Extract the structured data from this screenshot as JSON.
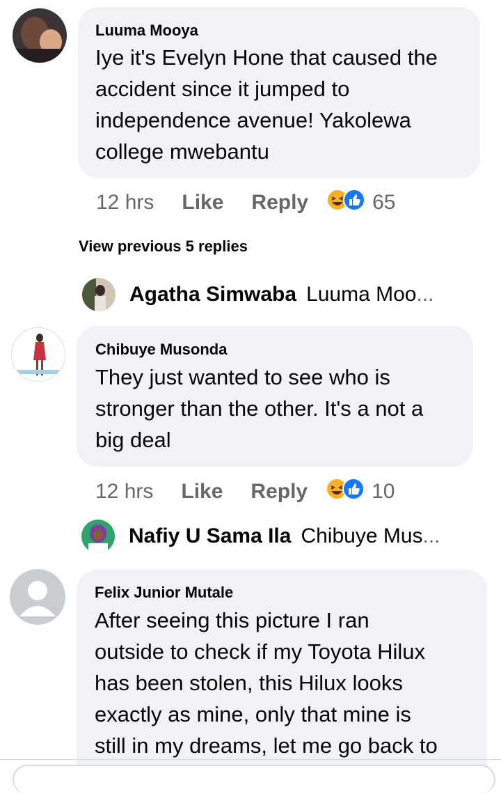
{
  "comments": [
    {
      "author": "Luuma Mooya",
      "lines": [
        "Iye it's Evelyn Hone that caused the",
        "accident since it jumped to",
        "independence avenue! Yakolewa",
        "college mwebantu"
      ],
      "time": "12 hrs",
      "like_label": "Like",
      "reply_label": "Reply",
      "reaction_count": "65"
    },
    {
      "author": "Chibuye Musonda",
      "lines": [
        "They just wanted to see who is",
        "stronger than the other. It's a not a",
        "big deal"
      ],
      "time": "12 hrs",
      "like_label": "Like",
      "reply_label": "Reply",
      "reaction_count": "10"
    },
    {
      "author": "Felix Junior Mutale",
      "lines": [
        "After seeing this picture I ran",
        "outside to check if my Toyota Hilux",
        "has been stolen, this Hilux looks",
        "exactly as mine, only that mine is",
        "still in my dreams, let me go back to"
      ]
    }
  ],
  "view_previous": "View previous 5 replies",
  "replies": [
    {
      "name": "Agatha Simwaba",
      "snippet": "Luuma Moo",
      "ellipsis": "..."
    },
    {
      "name": "Nafiy U Sama Ila",
      "snippet": "Chibuye Mus",
      "ellipsis": "..."
    }
  ],
  "icons": {
    "reaction_haha": "haha-reaction-icon",
    "reaction_like": "like-reaction-icon",
    "default_avatar": "person-silhouette-icon"
  },
  "colors": {
    "bubble": "#f0f2f5",
    "secondary_text": "#65676b",
    "like_blue": "#1877f2",
    "haha_yellow": "#f7b125"
  }
}
